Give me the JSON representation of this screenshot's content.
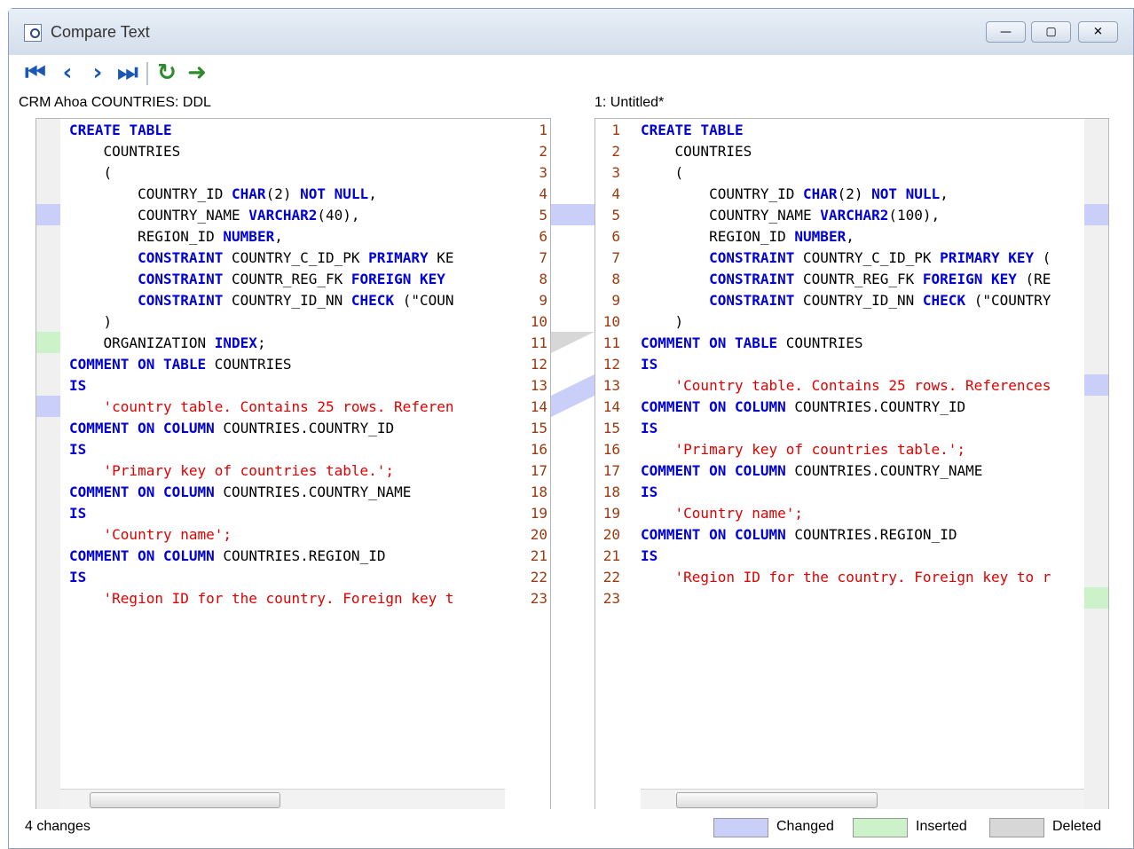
{
  "window": {
    "title": "Compare Text",
    "left_label": "CRM Ahoa COUNTRIES: DDL",
    "right_label": "1: Untitled*",
    "status": "4 changes"
  },
  "legend": [
    {
      "label": "Changed",
      "color": "#c9cff8"
    },
    {
      "label": "Inserted",
      "color": "#cbf2c8"
    },
    {
      "label": "Deleted",
      "color": "#d7d7d7"
    }
  ],
  "icons": [
    "first-diff-icon",
    "prev-diff-icon",
    "next-diff-icon",
    "last-diff-icon",
    "refresh-icon",
    "export-icon"
  ],
  "left_lines": [
    "CREATE TABLE",
    "    COUNTRIES",
    "    (",
    "        COUNTRY_ID CHAR(2) NOT NULL,",
    "        COUNTRY_NAME VARCHAR2(40),",
    "        REGION_ID NUMBER,",
    "        CONSTRAINT COUNTRY_C_ID_PK PRIMARY KE",
    "        CONSTRAINT COUNTR_REG_FK FOREIGN KEY",
    "        CONSTRAINT COUNTRY_ID_NN CHECK (\"COUN",
    "    )",
    "    ORGANIZATION INDEX;",
    "COMMENT ON TABLE COUNTRIES",
    "IS",
    "    'country table. Contains 25 rows. Referen",
    "COMMENT ON COLUMN COUNTRIES.COUNTRY_ID",
    "IS",
    "    'Primary key of countries table.';",
    "COMMENT ON COLUMN COUNTRIES.COUNTRY_NAME",
    "IS",
    "    'Country name';",
    "COMMENT ON COLUMN COUNTRIES.REGION_ID",
    "IS",
    "    'Region ID for the country. Foreign key t"
  ],
  "right_lines": [
    "CREATE TABLE",
    "    COUNTRIES",
    "    (",
    "        COUNTRY_ID CHAR(2) NOT NULL,",
    "        COUNTRY_NAME VARCHAR2(100),",
    "        REGION_ID NUMBER,",
    "        CONSTRAINT COUNTRY_C_ID_PK PRIMARY KEY (",
    "        CONSTRAINT COUNTR_REG_FK FOREIGN KEY (RE",
    "        CONSTRAINT COUNTRY_ID_NN CHECK (\"COUNTRY",
    "    )",
    "COMMENT ON TABLE COUNTRIES",
    "IS",
    "    'Country table. Contains 25 rows. References",
    "COMMENT ON COLUMN COUNTRIES.COUNTRY_ID",
    "IS",
    "    'Primary key of countries table.';",
    "COMMENT ON COLUMN COUNTRIES.COUNTRY_NAME",
    "IS",
    "    'Country name';",
    "COMMENT ON COLUMN COUNTRIES.REGION_ID",
    "IS",
    "    'Region ID for the country. Foreign key to r",
    ""
  ]
}
